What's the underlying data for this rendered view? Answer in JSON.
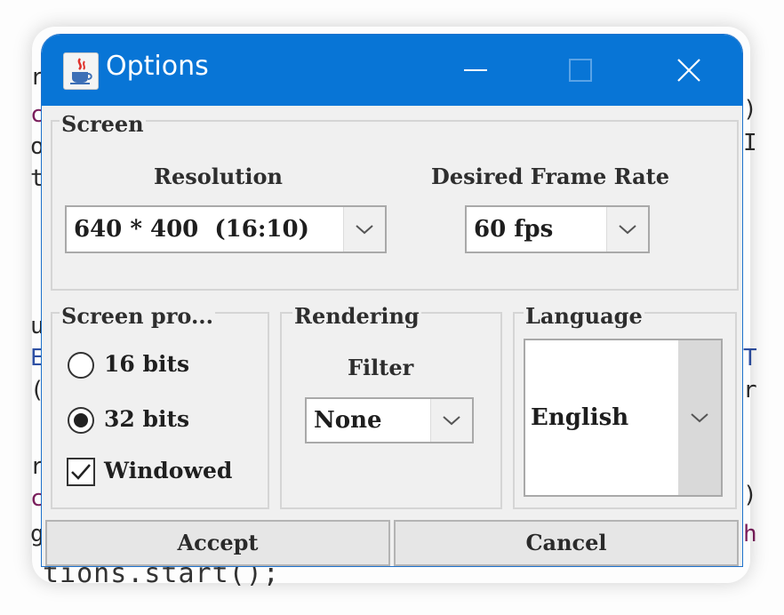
{
  "window": {
    "title": "Options"
  },
  "screen_group": {
    "title": "Screen",
    "resolution_label": "Resolution",
    "resolution_value": "640 * 400  (16:10)",
    "frame_rate_label": "Desired Frame Rate",
    "frame_rate_value": "60 fps"
  },
  "screen_profile_group": {
    "title": "Screen pro...",
    "options": [
      {
        "label": "16 bits",
        "selected": false
      },
      {
        "label": "32 bits",
        "selected": true
      }
    ],
    "windowed_label": "Windowed",
    "windowed_checked": true
  },
  "rendering_group": {
    "title": "Rendering",
    "filter_label": "Filter",
    "filter_value": "None"
  },
  "language_group": {
    "title": "Language",
    "value": "English"
  },
  "buttons": {
    "accept": "Accept",
    "cancel": "Cancel"
  },
  "colors": {
    "titlebar": "#0875d6",
    "dialog_bg": "#f0f0f0"
  }
}
